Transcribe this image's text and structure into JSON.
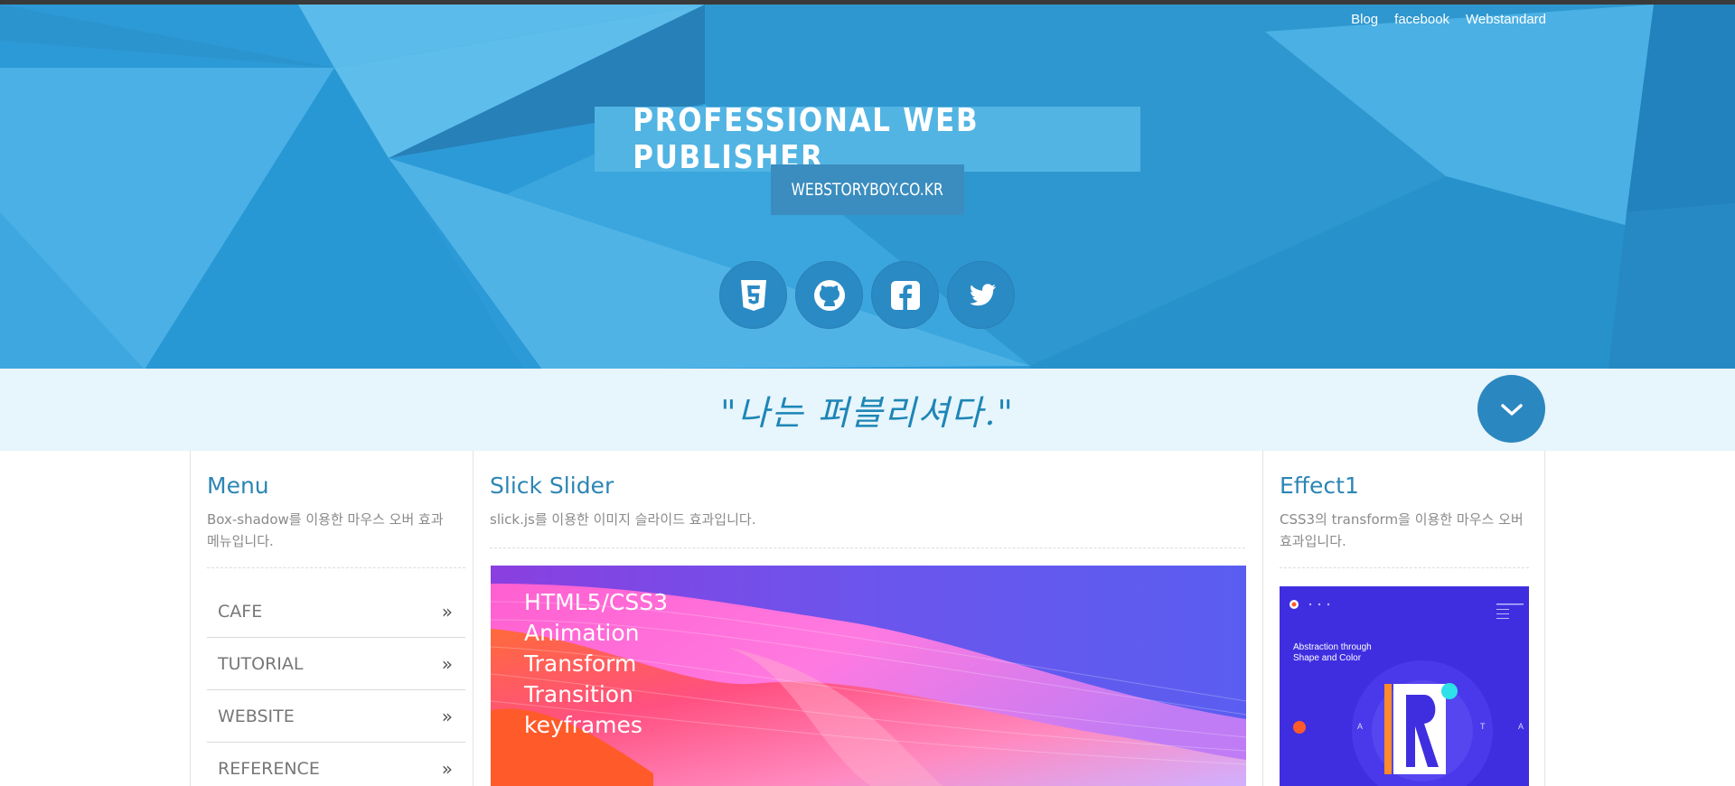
{
  "header": {
    "top_links": [
      "Blog",
      "facebook",
      "Webstandard"
    ],
    "title": "PROFESSIONAL WEB PUBLISHER",
    "subtitle": "WEBSTORYBOY.CO.KR",
    "socials": [
      "html5-icon",
      "github-icon",
      "facebook-icon",
      "twitter-icon"
    ],
    "colors": {
      "hero": "#2c9bd6",
      "title_box": "#52b4e3",
      "subtitle_box": "#3a8dbe",
      "social_bg": "#2a8ac4"
    }
  },
  "quote": {
    "text": "\"나는 퍼블리셔다.\"",
    "scroll_icon": "chevron-down-icon",
    "colors": {
      "bar": "#e7f5fc",
      "text": "#1d86b6",
      "button": "#2b87bf"
    }
  },
  "menu": {
    "title": "Menu",
    "description": "Box-shadow를 이용한 마우스 오버 효과 메뉴입니다.",
    "items": [
      {
        "label": "CAFE",
        "icon": "double-chevron-right-icon"
      },
      {
        "label": "TUTORIAL",
        "icon": "double-chevron-right-icon"
      },
      {
        "label": "WEBSITE",
        "icon": "double-chevron-right-icon"
      },
      {
        "label": "REFERENCE",
        "icon": "double-chevron-right-icon"
      }
    ]
  },
  "slider": {
    "title": "Slick Slider",
    "description": "slick.js를 이용한 이미지 슬라이드 효과입니다.",
    "slide_lines": [
      "HTML5/CSS3",
      "Animation",
      "Transform",
      "Transition",
      "keyframes"
    ]
  },
  "effect": {
    "title": "Effect1",
    "description": "CSS3의 transform을 이용한 마우스 오버효과입니다.",
    "image_title_line1": "Abstraction through",
    "image_title_line2": "Shape and Color",
    "image_letters": [
      "A",
      "T",
      "A"
    ],
    "accent": "#3f2ee0"
  }
}
